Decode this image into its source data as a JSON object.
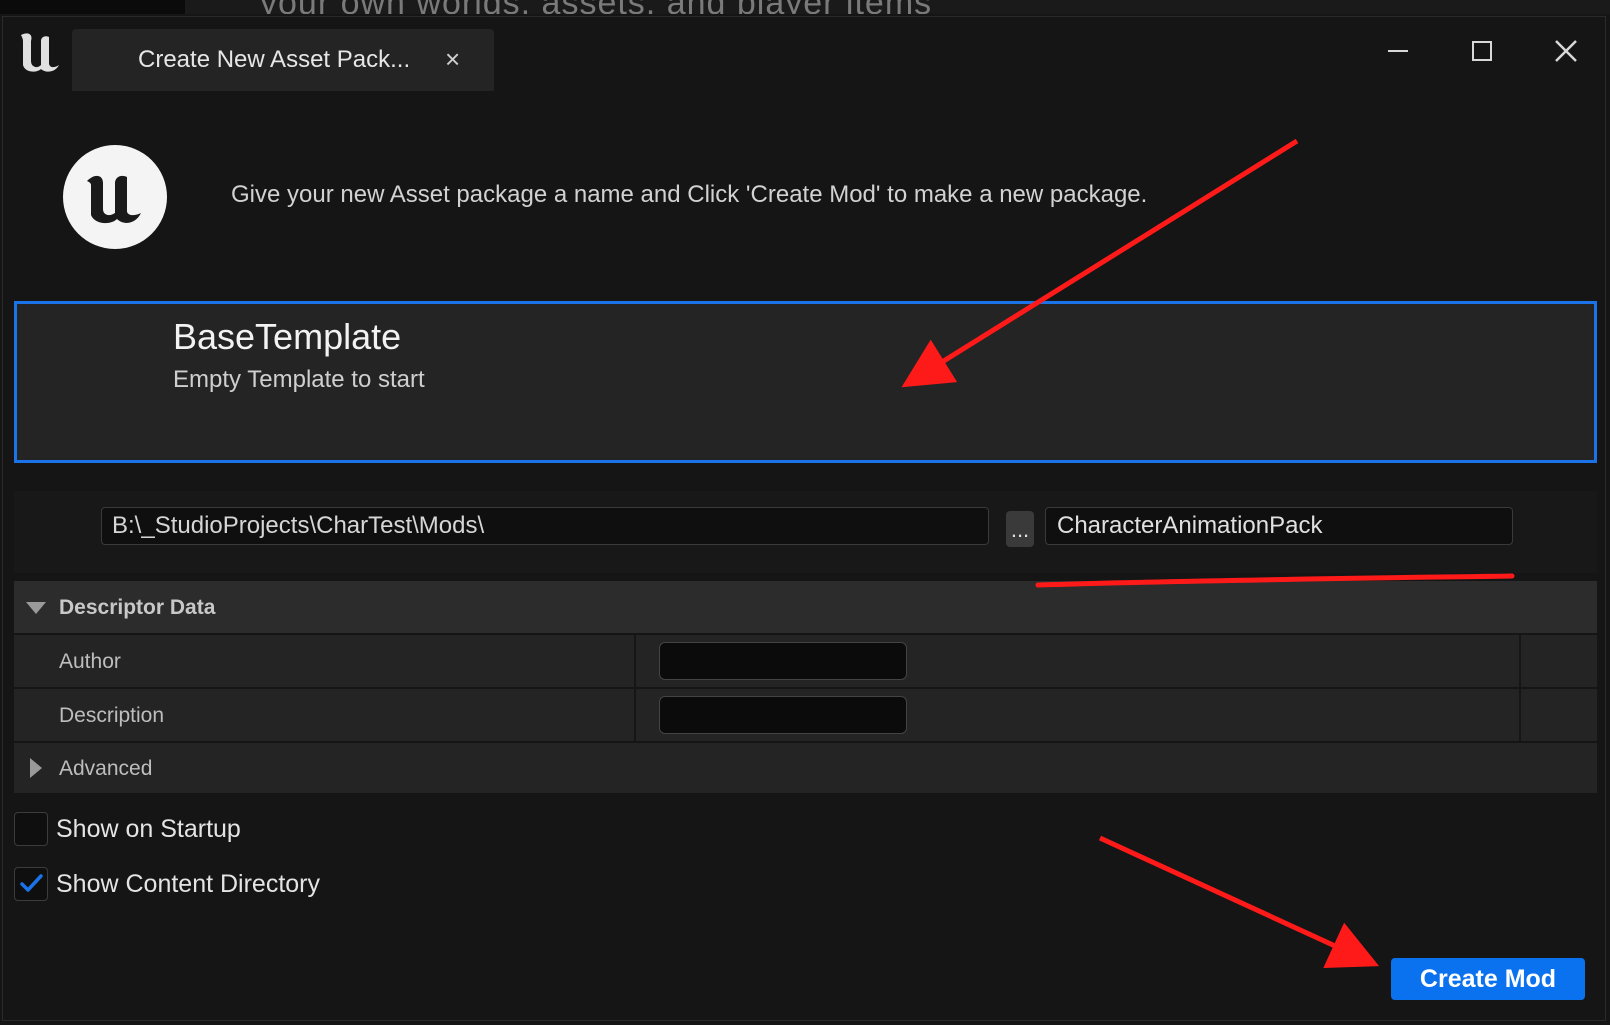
{
  "background": {
    "partial_text": "your own worlds, assets, and player items"
  },
  "window": {
    "tab_title": "Create New Asset Pack...",
    "tab_close": "×"
  },
  "intro": {
    "text": "Give your new Asset package a name and Click 'Create Mod' to make a new package."
  },
  "template": {
    "name": "BaseTemplate",
    "description": "Empty Template to start"
  },
  "path": {
    "value": "B:\\_StudioProjects\\CharTest\\Mods\\",
    "browse_label": "...",
    "name_value": "CharacterAnimationPack"
  },
  "descriptor": {
    "header": "Descriptor Data",
    "author_label": "Author",
    "author_value": "",
    "description_label": "Description",
    "description_value": "",
    "advanced_label": "Advanced"
  },
  "options": {
    "show_on_startup_label": "Show on Startup",
    "show_on_startup_checked": false,
    "show_content_directory_label": "Show Content Directory",
    "show_content_directory_checked": true
  },
  "actions": {
    "create_label": "Create Mod"
  },
  "colors": {
    "accent": "#1a73e8",
    "button": "#0a72ef",
    "annotation": "#ff1a1a"
  }
}
